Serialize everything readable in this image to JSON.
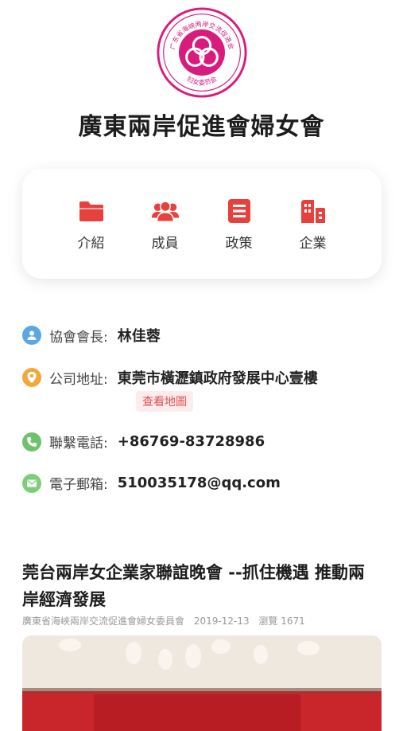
{
  "org": {
    "name": "廣東兩岸促進會婦女會",
    "logo_arc_text": "广东省海峡两岸交流促进会",
    "logo_bottom_text": "妇女委员会"
  },
  "nav": [
    {
      "label": "介紹",
      "icon": "folder-icon"
    },
    {
      "label": "成員",
      "icon": "users-icon"
    },
    {
      "label": "政策",
      "icon": "document-icon"
    },
    {
      "label": "企業",
      "icon": "building-icon"
    }
  ],
  "info": {
    "president_label": "協會會長:",
    "president_value": "林佳蓉",
    "address_label": "公司地址:",
    "address_value": "東莞市橫瀝鎮政府發展中心壹樓",
    "map_button": "查看地圖",
    "phone_label": "聯繫電話:",
    "phone_value": "+86769-83728986",
    "email_label": "電子郵箱:",
    "email_value": "510035178@qq.com"
  },
  "article": {
    "title": "莞台兩岸女企業家聯誼晚會 --抓住機遇 推動兩岸經濟發展",
    "source": "廣東省海峽兩岸交流促進會婦女委員會",
    "date": "2019-12-13",
    "views": "瀏覽 1671"
  },
  "colors": {
    "accent": "#e8413d",
    "logo_pink": "#d81b7c",
    "person_blue": "#5aa7e8",
    "location_orange": "#f2a93b",
    "phone_green": "#6cc36c",
    "mail_green": "#7ccf78"
  }
}
